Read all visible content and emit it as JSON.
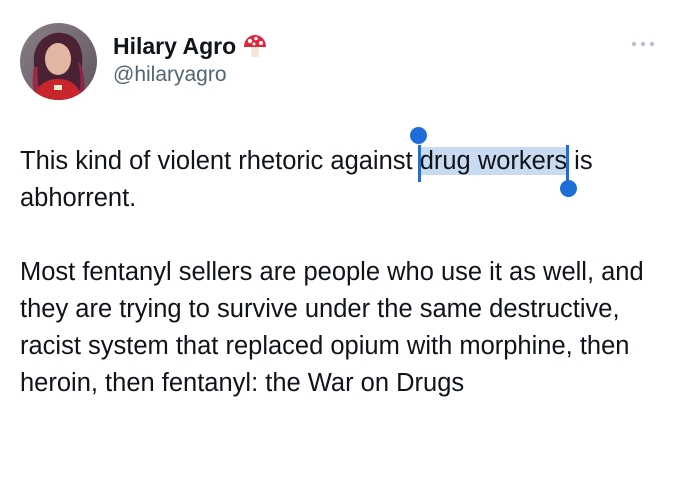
{
  "author": {
    "display_name": "Hilary Agro",
    "handle": "@hilaryagro",
    "badge_icon": "mushroom-icon"
  },
  "menu": {
    "icon": "more-icon"
  },
  "tweet": {
    "para1_before": "This kind of violent rhetoric against ",
    "para1_selected": "drug workers",
    "para1_after": " is abhorrent.",
    "para2": "Most fentanyl sellers are people who use it as well, and they are trying to survive under the same destructive, racist system that replaced opium with morphine, then heroin, then fentanyl: the War on Drugs"
  },
  "colors": {
    "selection_highlight": "#c9dbf0",
    "selection_handle": "#1d6ed8",
    "secondary_text": "#536471"
  }
}
